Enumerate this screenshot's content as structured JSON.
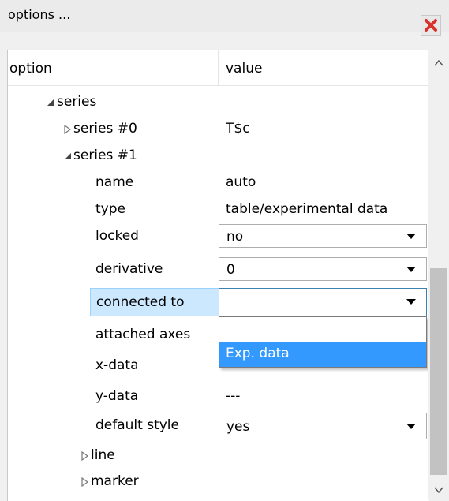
{
  "window": {
    "title": "options ..."
  },
  "header": {
    "option": "option",
    "value": "value"
  },
  "tree": {
    "series": "series",
    "series0": {
      "label": "series #0",
      "value": "T$c"
    },
    "series1": "series #1",
    "name": {
      "label": "name",
      "value": "auto"
    },
    "type": {
      "label": "type",
      "value": "table/experimental data"
    },
    "locked": {
      "label": "locked",
      "value": "no"
    },
    "derivative": {
      "label": "derivative",
      "value": "0"
    },
    "connected_to": {
      "label": "connected to",
      "value": ""
    },
    "attached_axes": {
      "label": "attached axes"
    },
    "x_data": {
      "label": "x-data"
    },
    "y_data": {
      "label": "y-data",
      "value": "---"
    },
    "default_style": {
      "label": "default style",
      "value": "yes"
    },
    "line": "line",
    "marker": "marker"
  },
  "dropdown": {
    "options": [
      "",
      "Exp. data"
    ],
    "highlighted": "Exp. data"
  },
  "icons": {
    "close": "close-icon",
    "expand": "expand-arrow-icon",
    "collapse": "collapse-arrow-icon"
  },
  "colors": {
    "selection": "#cce8ff",
    "highlight": "#3399ff",
    "close": "#d9322c"
  }
}
